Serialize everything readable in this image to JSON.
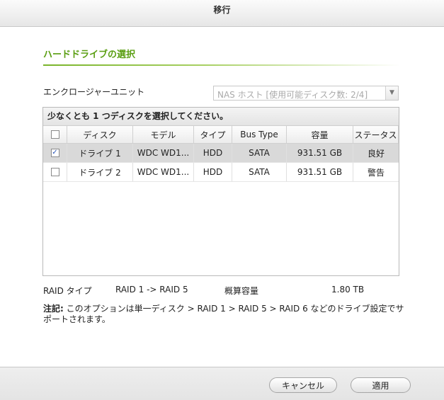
{
  "dialog": {
    "title": "移行"
  },
  "section": {
    "title": "ハードドライブの選択"
  },
  "enclosure": {
    "label": "エンクロージャーユニット",
    "value": "NAS ホスト [使用可能ディスク数: 2/4]"
  },
  "grid": {
    "instruction": "少なくとも 1 つディスクを選択してください。",
    "columns": [
      "ディスク",
      "モデル",
      "タイプ",
      "Bus Type",
      "容量",
      "ステータス"
    ],
    "rows": [
      {
        "checked": "✓",
        "disk": "ドライブ 1",
        "model": "WDC WD1...",
        "type": "HDD",
        "bus": "SATA",
        "capacity": "931.51 GB",
        "status": "良好"
      },
      {
        "checked": "",
        "disk": "ドライブ 2",
        "model": "WDC WD1...",
        "type": "HDD",
        "bus": "SATA",
        "capacity": "931.51 GB",
        "status": "警告"
      }
    ]
  },
  "raid": {
    "type_label": "RAID タイプ",
    "type_value": "RAID 1 -> RAID 5",
    "capacity_label": "概算容量",
    "capacity_value": "1.80 TB"
  },
  "note": {
    "label": "注記:",
    "text": " このオプションは単一ディスク > RAID 1 > RAID 5 > RAID 6 などのドライブ設定でサポートされます。"
  },
  "buttons": {
    "cancel": "キャンセル",
    "apply": "適用"
  }
}
